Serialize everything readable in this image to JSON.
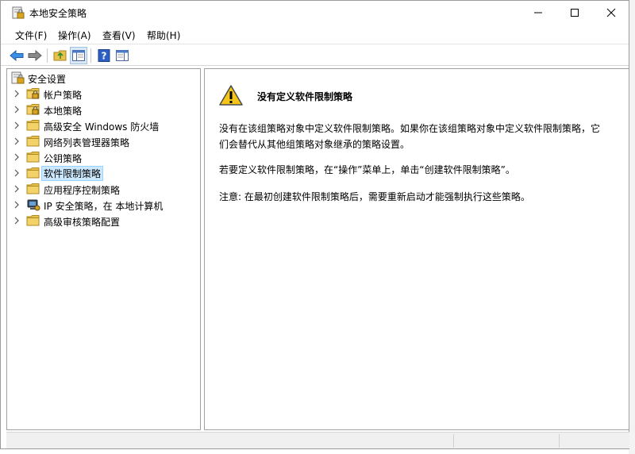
{
  "window": {
    "title": "本地安全策略"
  },
  "menu": {
    "items": [
      "文件(F)",
      "操作(A)",
      "查看(V)",
      "帮助(H)"
    ]
  },
  "tree": {
    "root": "安全设置",
    "items": [
      {
        "label": "帐户策略",
        "icon": "folder-lock-icon"
      },
      {
        "label": "本地策略",
        "icon": "folder-lock-icon"
      },
      {
        "label": "高级安全 Windows 防火墙",
        "icon": "folder-icon"
      },
      {
        "label": "网络列表管理器策略",
        "icon": "folder-icon"
      },
      {
        "label": "公钥策略",
        "icon": "folder-icon"
      },
      {
        "label": "软件限制策略",
        "icon": "folder-icon",
        "selected": true
      },
      {
        "label": "应用程序控制策略",
        "icon": "folder-icon"
      },
      {
        "label": "IP 安全策略，在 本地计算机",
        "icon": "ip-security-icon"
      },
      {
        "label": "高级审核策略配置",
        "icon": "folder-icon"
      }
    ]
  },
  "content": {
    "heading": "没有定义软件限制策略",
    "para1": "没有在该组策略对象中定义软件限制策略。如果你在该组策略对象中定义软件限制策略，它们会替代从其他组策略对象继承的策略设置。",
    "para2": "若要定义软件限制策略，在“操作”菜单上，单击“创建软件限制策略”。",
    "para3": "注意: 在最初创建软件限制策略后，需要重新启动才能强制执行这些策略。"
  }
}
